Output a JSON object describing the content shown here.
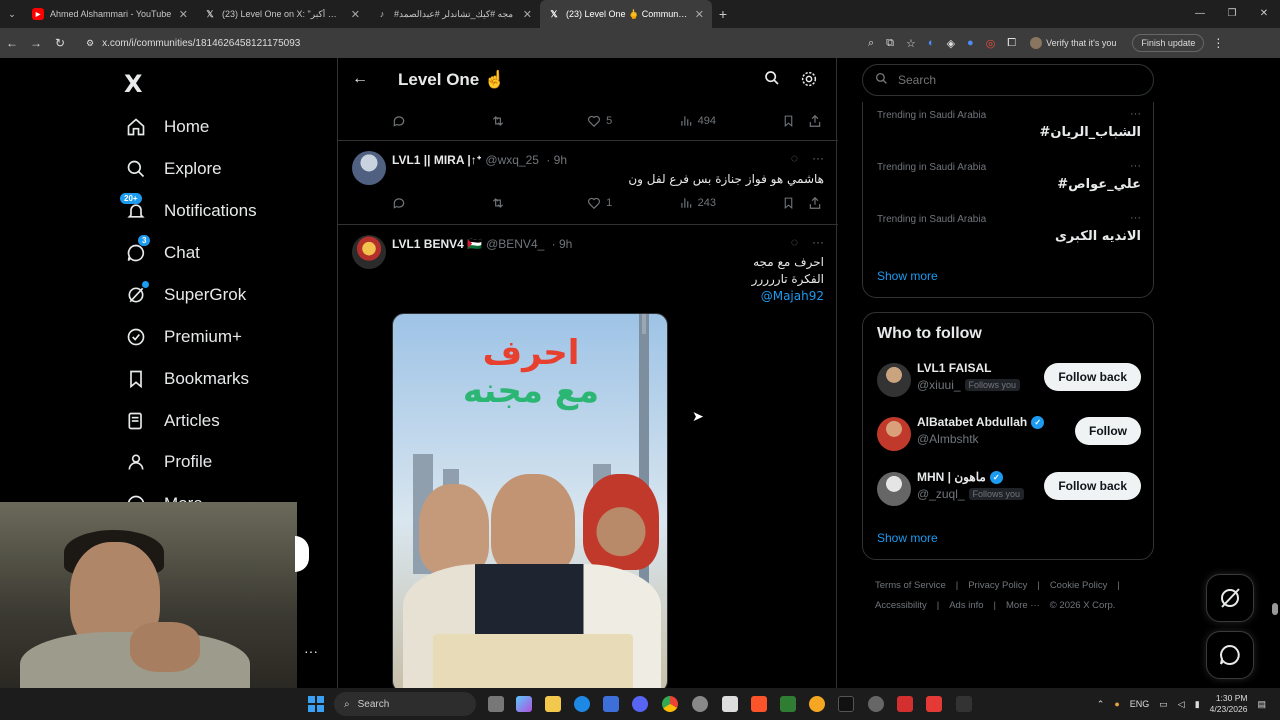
{
  "browser": {
    "tabs": [
      {
        "label": "Ahmed Alshammari - YouTube",
        "favicon": "youtube-icon",
        "active": false
      },
      {
        "label": "(23) Level One on X: \"الهدف أكبر",
        "favicon": "x-icon",
        "active": false
      },
      {
        "label": "#مجه #كيك_تشاندلر #عبدالصمد",
        "favicon": "tiktok-icon",
        "active": false
      },
      {
        "label": "(23) Level One 🖕 Community / X",
        "favicon": "x-icon",
        "active": true
      }
    ],
    "url": "x.com/i/communities/1814626458121175093",
    "verify_label": "Verify that it's you",
    "finish_label": "Finish update"
  },
  "nav": {
    "logo": "X",
    "items": [
      {
        "label": "Home",
        "icon": "home-icon"
      },
      {
        "label": "Explore",
        "icon": "search-icon"
      },
      {
        "label": "Notifications",
        "icon": "bell-icon",
        "badge": "20+"
      },
      {
        "label": "Chat",
        "icon": "chat-icon",
        "badge": "3"
      },
      {
        "label": "SuperGrok",
        "icon": "grok-icon"
      },
      {
        "label": "Premium+",
        "icon": "premium-icon"
      },
      {
        "label": "Bookmarks",
        "icon": "bookmark-icon"
      },
      {
        "label": "Articles",
        "icon": "articles-icon"
      },
      {
        "label": "Profile",
        "icon": "profile-icon"
      },
      {
        "label": "More",
        "icon": "more-icon"
      }
    ],
    "more_dots": "···"
  },
  "community": {
    "title": "Level One ☝️",
    "first_actions": {
      "likes": "5",
      "views": "494"
    },
    "posts": [
      {
        "name": "LVL1 || MIRA |↑ᐩ",
        "handle": "@wxq_25",
        "time": "· 9h",
        "text": "هاشمي هو فواز جنازة بس فرع لفل ون",
        "likes": "1",
        "views": "243"
      },
      {
        "name": "LVL1 BENV4 🇵🇸",
        "handle": "@BENV4_",
        "time": "· 9h",
        "text_line1": "احرف مع مجه",
        "text_line2": "الفكرة تاررررر",
        "mention": "@Majah92",
        "media_line1": "احرف",
        "media_line2": "مع مجنه"
      }
    ]
  },
  "right": {
    "search_placeholder": "Search",
    "trends": [
      {
        "context": "Trending in Saudi Arabia",
        "name": "#الشباب_الريان"
      },
      {
        "context": "Trending in Saudi Arabia",
        "name": "#علي_عواص"
      },
      {
        "context": "Trending in Saudi Arabia",
        "name": "الانديه الكبرى"
      }
    ],
    "trends_show_more": "Show more",
    "who_to_follow_title": "Who to follow",
    "who_to_follow": [
      {
        "name": "LVL1 FAISAL",
        "handle": "@xiuui_",
        "follows_you": "Follows you",
        "button": "Follow back",
        "verified": false
      },
      {
        "name": "AlBatabet Abdullah",
        "handle": "@Almbshtk",
        "follows_you": "",
        "button": "Follow",
        "verified": true
      },
      {
        "name": "MHN | ماهون",
        "handle": "@_zuql_",
        "follows_you": "Follows you",
        "button": "Follow back",
        "verified": true
      }
    ],
    "wtf_show_more": "Show more",
    "footer_links": [
      "Terms of Service",
      "|",
      "Privacy Policy",
      "|",
      "Cookie Policy",
      "|",
      "Accessibility",
      "|",
      "Ads info",
      "|",
      "More ···",
      "© 2026 X Corp."
    ]
  },
  "taskbar": {
    "search_label": "Search",
    "lang": "ENG",
    "time": "1:30 PM",
    "date": "4/23/2026"
  },
  "colors": {
    "accent": "#1d9bf0",
    "background": "#000000",
    "border": "#2f3336",
    "muted_text": "#71767b"
  }
}
